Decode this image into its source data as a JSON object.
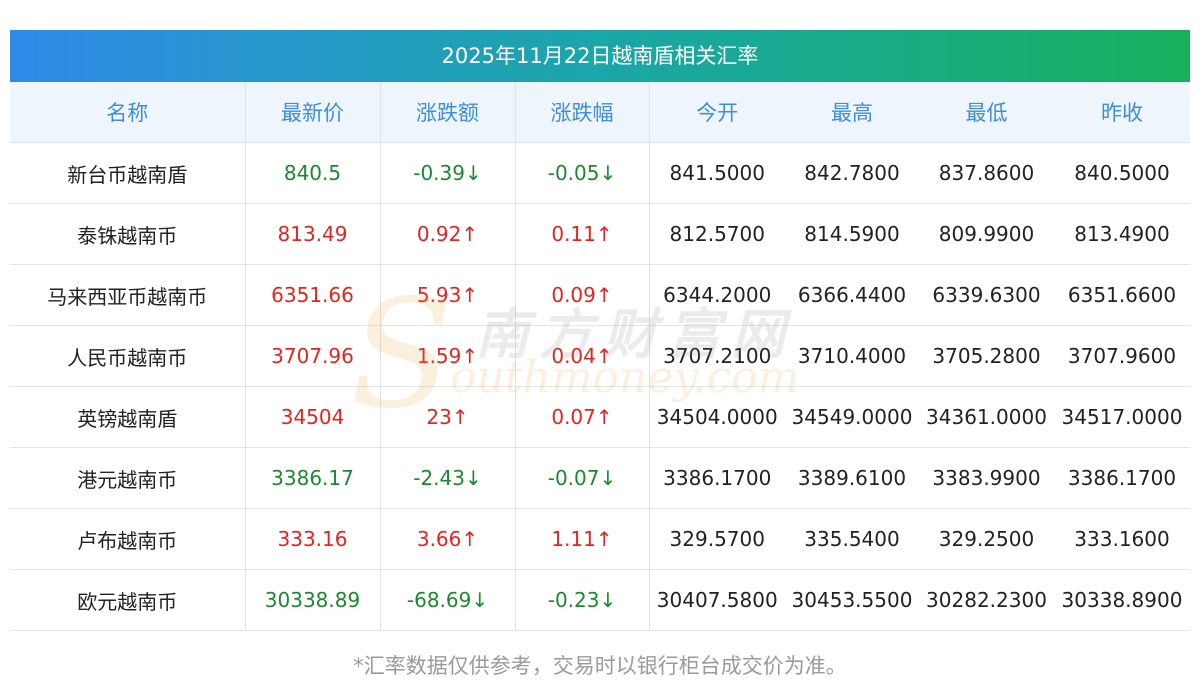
{
  "title": "2025年11月22日越南盾相关汇率",
  "columns": [
    "名称",
    "最新价",
    "涨跌额",
    "涨跌幅",
    "今开",
    "最高",
    "最低",
    "昨收"
  ],
  "rows": [
    {
      "name": "新台币越南盾",
      "latest": "840.5",
      "change": "-0.39↓",
      "pct": "-0.05↓",
      "open": "841.5000",
      "high": "842.7800",
      "low": "837.8600",
      "prev": "840.5000",
      "dir": "down"
    },
    {
      "name": "泰铢越南币",
      "latest": "813.49",
      "change": "0.92↑",
      "pct": "0.11↑",
      "open": "812.5700",
      "high": "814.5900",
      "low": "809.9900",
      "prev": "813.4900",
      "dir": "up"
    },
    {
      "name": "马来西亚币越南币",
      "latest": "6351.66",
      "change": "5.93↑",
      "pct": "0.09↑",
      "open": "6344.2000",
      "high": "6366.4400",
      "low": "6339.6300",
      "prev": "6351.6600",
      "dir": "up"
    },
    {
      "name": "人民币越南币",
      "latest": "3707.96",
      "change": "1.59↑",
      "pct": "0.04↑",
      "open": "3707.2100",
      "high": "3710.4000",
      "low": "3705.2800",
      "prev": "3707.9600",
      "dir": "up"
    },
    {
      "name": "英镑越南盾",
      "latest": "34504",
      "change": "23↑",
      "pct": "0.07↑",
      "open": "34504.0000",
      "high": "34549.0000",
      "low": "34361.0000",
      "prev": "34517.0000",
      "dir": "up"
    },
    {
      "name": "港元越南币",
      "latest": "3386.17",
      "change": "-2.43↓",
      "pct": "-0.07↓",
      "open": "3386.1700",
      "high": "3389.6100",
      "low": "3383.9900",
      "prev": "3386.1700",
      "dir": "down"
    },
    {
      "name": "卢布越南币",
      "latest": "333.16",
      "change": "3.66↑",
      "pct": "1.11↑",
      "open": "329.5700",
      "high": "335.5400",
      "low": "329.2500",
      "prev": "333.1600",
      "dir": "up"
    },
    {
      "name": "欧元越南币",
      "latest": "30338.89",
      "change": "-68.69↓",
      "pct": "-0.23↓",
      "open": "30407.5800",
      "high": "30453.5500",
      "low": "30282.2300",
      "prev": "30338.8900",
      "dir": "down"
    }
  ],
  "watermark": {
    "cn": "南方财富网",
    "en": "outhmoney.com",
    "letter": "S"
  },
  "footer": "*汇率数据仅供参考，交易时以银行柜台成交价为准。",
  "colors": {
    "up": "#e8231f",
    "down": "#1a8a2e",
    "header_text": "#3d8de0",
    "header_bg": "#eef5fc",
    "title_start": "#2f8ae8",
    "title_end": "#17b05c"
  }
}
